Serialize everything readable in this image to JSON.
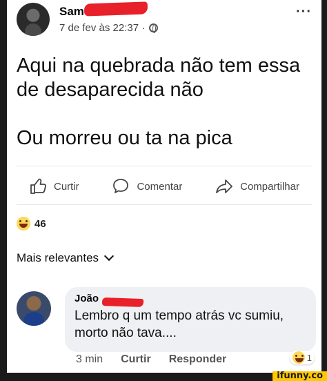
{
  "post": {
    "author": "Sam",
    "timestamp": "7 de fev às 22:37 ·",
    "text_lines": [
      "Aqui na quebrada não tem essa de desaparecida não",
      "Ou morreu ou ta na pica"
    ]
  },
  "actions": {
    "like": "Curtir",
    "comment": "Comentar",
    "share": "Compartilhar"
  },
  "reactions": {
    "count": "46"
  },
  "comments_sort": "Mais relevantes",
  "comment": {
    "author": "João",
    "text": "Lembro q um tempo atrás vc sumiu, morto não tava....",
    "time": "3 min",
    "like": "Curtir",
    "reply": "Responder",
    "reaction_count": "1"
  },
  "watermark": "ifunny.co",
  "colors": {
    "redaction": "#e8202a",
    "watermark_bg": "#ffc800"
  }
}
